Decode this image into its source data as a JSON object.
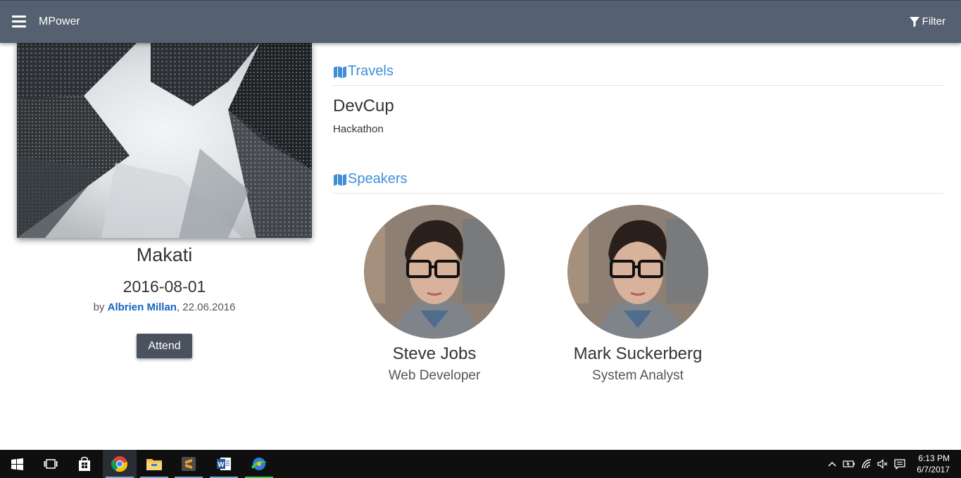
{
  "appbar": {
    "title": "MPower",
    "filter_label": "Filter"
  },
  "event": {
    "city": "Makati",
    "date": "2016-08-01",
    "by_prefix": "by",
    "author": "Albrien Millan",
    "posted": ", 22.06.2016",
    "attend_label": "Attend"
  },
  "sections": {
    "travels_heading": "Travels",
    "speakers_heading": "Speakers"
  },
  "travel": {
    "title": "DevCup",
    "subtitle": "Hackathon"
  },
  "speakers": [
    {
      "name": "Steve Jobs",
      "role": "Web Developer"
    },
    {
      "name": "Mark Suckerberg",
      "role": "System Analyst"
    }
  ],
  "taskbar": {
    "apps": [
      "start-icon",
      "task-view-icon",
      "store-icon",
      "chrome-icon",
      "file-explorer-icon",
      "sublime-text-icon",
      "word-icon",
      "green-app-icon"
    ],
    "clock_time": "6:13 PM",
    "clock_date": "6/7/2017"
  },
  "colors": {
    "appbar": "#556170",
    "heading_blue": "#3f8fd8",
    "author_link": "#1565c0",
    "attend_button": "#4a5260",
    "taskbar": "#0f0f10"
  }
}
